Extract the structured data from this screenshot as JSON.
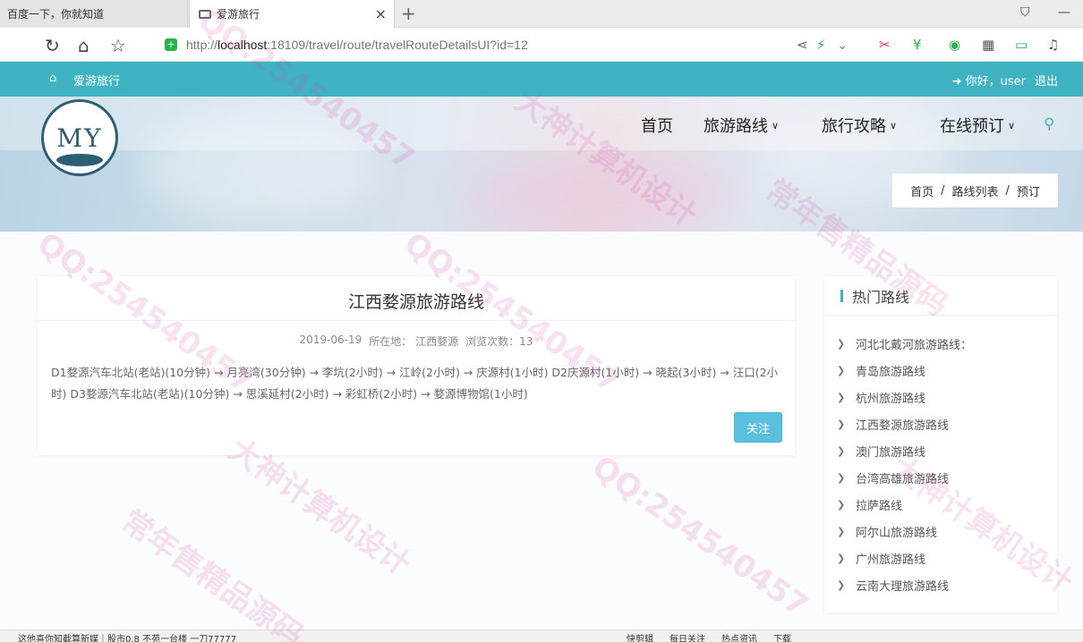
{
  "browser": {
    "tabs": [
      {
        "label": "百度一下，你就知道"
      },
      {
        "label": "爱游旅行"
      }
    ],
    "url_prefix": "http://",
    "url_host": "localhost",
    "url_rest": ":18109/travel/route/travelRouteDetailsUI?id=12"
  },
  "site": {
    "brand": "爱游旅行",
    "greeting": "你好，user",
    "logout": "退出",
    "logo_text": "MY",
    "nav": [
      {
        "label": "首页"
      },
      {
        "label": "旅游路线"
      },
      {
        "label": "旅行攻略"
      },
      {
        "label": "在线预订"
      }
    ],
    "breadcrumb": [
      "首页",
      "路线列表",
      "预订"
    ]
  },
  "route": {
    "title": "江西婺源旅游路线",
    "date": "2019-06-19",
    "location_label": "所在地：",
    "location": "江西婺源",
    "views_label": "浏览次数：",
    "views": "13",
    "description": "D1婺源汽车北站(老站)(10分钟) → 月亮湾(30分钟) → 李坑(2小时) → 江岭(2小时) → 庆源村(1小时) D2庆源村(1小时) → 晓起(3小时) → 汪口(2小时) D3婺源汽车北站(老站)(10分钟) → 思溪延村(2小时) → 彩虹桥(2小时) → 婺源博物馆(1小时)",
    "follow_label": "关注"
  },
  "sidebar": {
    "title": "热门路线",
    "items": [
      "河北北戴河旅游路线：",
      "青岛旅游路线",
      "杭州旅游路线",
      "江西婺源旅游路线",
      "澳门旅游路线",
      "台湾高雄旅游路线",
      "拉萨路线",
      "阿尔山旅游路线",
      "广州旅游路线",
      "云南大理旅游路线"
    ]
  },
  "statusbar": {
    "left": "这他喜你知截算新媒｜股市0.8 不苑一台楼 一刀77777",
    "right": [
      "快剪辑",
      "每日关注",
      "热点资讯",
      "下载"
    ]
  },
  "watermark": [
    "QQ:254540457",
    "大神计算机设计",
    "常年售精品源码"
  ]
}
